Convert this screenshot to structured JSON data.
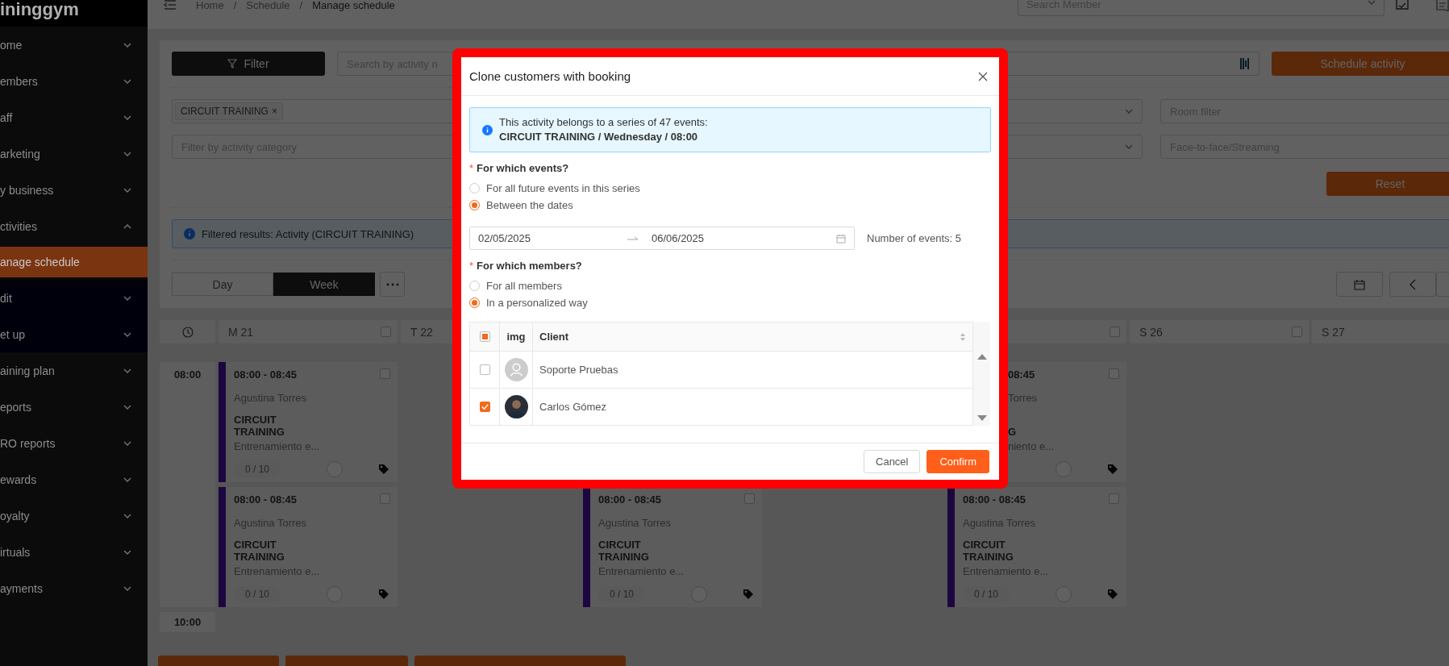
{
  "sidebar": {
    "logo": "ininggym",
    "items": [
      {
        "label": "ome",
        "expanded": false,
        "selected": false
      },
      {
        "label": "embers",
        "expanded": false,
        "selected": false
      },
      {
        "label": "aff",
        "expanded": false,
        "selected": false
      },
      {
        "label": "arketing",
        "expanded": false,
        "selected": false
      },
      {
        "label": "y business",
        "expanded": false,
        "selected": false
      },
      {
        "label": "ctivities",
        "expanded": true,
        "selected": false,
        "children": [
          {
            "label": "anage schedule",
            "selected": true
          },
          {
            "label": "dit",
            "expanded": false,
            "selected": false
          },
          {
            "label": "et up",
            "expanded": false,
            "selected": false
          }
        ]
      },
      {
        "label": "aining plan",
        "expanded": false,
        "selected": false
      },
      {
        "label": "eports",
        "expanded": false,
        "selected": false
      },
      {
        "label": "RO reports",
        "expanded": false,
        "selected": false
      },
      {
        "label": "ewards",
        "expanded": false,
        "selected": false
      },
      {
        "label": "oyalty",
        "expanded": false,
        "selected": false
      },
      {
        "label": "irtuals",
        "expanded": false,
        "selected": false
      },
      {
        "label": "ayments",
        "expanded": false,
        "selected": false
      }
    ]
  },
  "header": {
    "breadcrumb": [
      "Home",
      "Schedule",
      "Manage schedule"
    ],
    "separator": "/",
    "search": {
      "placeholder": "Search Member"
    }
  },
  "toolbar": {
    "filter_button": "Filter",
    "search": {
      "placeholder": "Search by activity n"
    },
    "schedule_button": "Schedule activity"
  },
  "filters": {
    "activity_tags": [
      "CIRCUIT TRAINING"
    ],
    "tag_remove": "×",
    "room": {
      "placeholder": "Room filter"
    },
    "category": {
      "placeholder": "Filter by activity category"
    },
    "mode": {
      "placeholder": "Face-to-face/Streaming"
    },
    "reset_button": "Reset"
  },
  "result_notice": "Filtered results: Activity (CIRCUIT TRAINING)",
  "view_tabs": [
    {
      "label": "Day",
      "selected": false
    },
    {
      "label": "Week",
      "selected": true
    }
  ],
  "calendar": {
    "times": [
      "08:00",
      "10:00"
    ],
    "days": [
      {
        "kind": "visible",
        "label": "M 21",
        "checked": false,
        "events": [
          {
            "kind": "full",
            "time": "08:00 - 08:45",
            "trainer": "Agustina Torres",
            "activity": "CIRCUIT TRAINING",
            "description": "Entrenamiento e...",
            "capacity": "0 / 10",
            "checked": false
          },
          {
            "kind": "full",
            "time": "08:00 - 08:45",
            "trainer": "Agustina Torres",
            "activity": "CIRCUIT TRAINING",
            "description": "Entrenamiento e...",
            "capacity": "0 / 10",
            "checked": false
          }
        ]
      },
      {
        "kind": "visible",
        "label": "T 22"
      },
      {
        "kind": "covered",
        "events": [
          {
            "kind": "covered"
          },
          {
            "kind": "full",
            "time": "08:00 - 08:45",
            "trainer": "Agustina Torres",
            "activity": "CIRCUIT TRAINING",
            "description": "Entrenamiento e...",
            "capacity": "0 / 10",
            "checked": false
          }
        ]
      },
      {
        "kind": "covered"
      },
      {
        "kind": "visible",
        "checked": false,
        "events": [
          {
            "kind": "partial",
            "time": "08:45",
            "trainer": "Torres",
            "activity": "G",
            "description": "niento e...",
            "checked": false
          },
          {
            "kind": "full",
            "time": "08:00 - 08:45",
            "trainer": "Agustina Torres",
            "activity": "CIRCUIT TRAINING",
            "description": "Entrenamiento e...",
            "capacity": "0 / 10",
            "checked": false
          }
        ]
      },
      {
        "kind": "visible",
        "label": "S 26",
        "checked": false
      },
      {
        "kind": "visible",
        "label": "S 27"
      }
    ]
  },
  "dialog": {
    "title": "Clone customers with booking",
    "notice": {
      "text": "This activity belongs to a series of 47 events:",
      "detail": "CIRCUIT TRAINING / Wednesday / 08:00"
    },
    "events_question": {
      "marker": "*",
      "label": "For which events?",
      "options": [
        {
          "label": "For all future events in this series",
          "selected": false
        },
        {
          "label": "Between the dates",
          "selected": true
        }
      ]
    },
    "date_range": {
      "start": "02/05/2025",
      "end": "06/06/2025"
    },
    "event_count": "Number of events: 5",
    "members_question": {
      "marker": "*",
      "label": "For which members?",
      "options": [
        {
          "label": "For all members",
          "selected": false
        },
        {
          "label": "In a personalized way",
          "selected": true
        }
      ]
    },
    "table": {
      "columns": [
        "img",
        "Client"
      ],
      "select_all": {
        "checked": false,
        "indeterminate": true
      },
      "rows": [
        {
          "checked": false,
          "has_photo": false,
          "client": "Soporte Pruebas"
        },
        {
          "checked": true,
          "has_photo": true,
          "client": "Carlos Gómez"
        }
      ]
    },
    "buttons": [
      {
        "label": "Cancel",
        "kind": "secondary"
      },
      {
        "label": "Confirm",
        "kind": "primary"
      }
    ]
  }
}
